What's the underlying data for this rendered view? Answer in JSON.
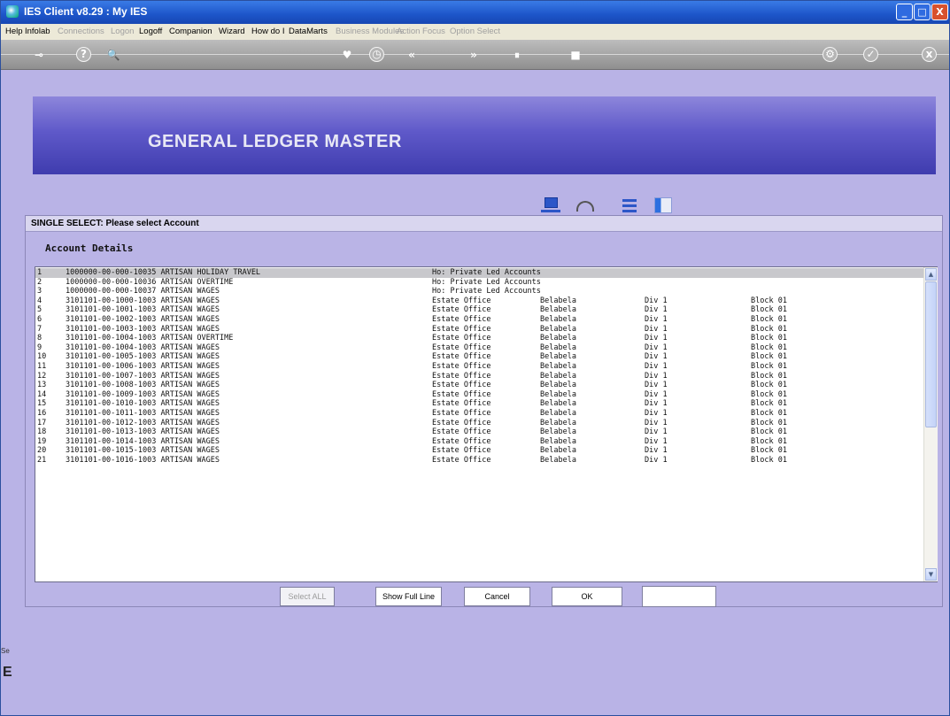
{
  "window": {
    "title": "IES Client v8.29 : My IES",
    "min": "_",
    "max": "□",
    "close": "X"
  },
  "menu": [
    {
      "label": "Help",
      "enabled": true
    },
    {
      "label": "Infolab",
      "enabled": true
    },
    {
      "label": "Connections",
      "enabled": false
    },
    {
      "label": "Logon",
      "enabled": false
    },
    {
      "label": "Logoff",
      "enabled": true
    },
    {
      "label": "Companion",
      "enabled": true
    },
    {
      "label": "Wizard",
      "enabled": true
    },
    {
      "label": "How do I",
      "enabled": true
    },
    {
      "label": "DataMarts",
      "enabled": true
    },
    {
      "label": "Business Modules",
      "enabled": false
    },
    {
      "label": "Action Focus",
      "enabled": false
    },
    {
      "label": "Option Select",
      "enabled": false
    }
  ],
  "toolbar": {
    "icons": [
      "key-icon",
      "help-icon",
      "search-icon",
      "heart-icon",
      "clock-icon",
      "rewind-icon",
      "forward-icon",
      "pause-icon",
      "stop-icon",
      "settings-icon",
      "check-icon",
      "close-icon"
    ],
    "glyphs": {
      "key": "⊸",
      "help": "?",
      "search": "🔍",
      "heart": "♥",
      "clock": "◷",
      "rewind": "«",
      "forward": "»",
      "pause": "⏸",
      "stop": "■",
      "settings": "⚙",
      "check": "✓",
      "close": "x"
    }
  },
  "banner": {
    "title": "GENERAL LEDGER MASTER"
  },
  "dialog": {
    "title": "SINGLE SELECT: Please select Account",
    "section_label": "Account Details",
    "rows": [
      {
        "n": "1",
        "acc": "1000000-00-000-10035 ARTISAN HOLIDAY TRAVEL",
        "f1": "Ho: Private Led Accounts",
        "f2": "",
        "f3": "",
        "f4": ""
      },
      {
        "n": "2",
        "acc": "1000000-00-000-10036 ARTISAN OVERTIME",
        "f1": "Ho: Private Led Accounts",
        "f2": "",
        "f3": "",
        "f4": ""
      },
      {
        "n": "3",
        "acc": "1000000-00-000-10037 ARTISAN WAGES",
        "f1": "Ho: Private Led Accounts",
        "f2": "",
        "f3": "",
        "f4": ""
      },
      {
        "n": "4",
        "acc": "3101101-00-1000-1003 ARTISAN WAGES",
        "f1": "Estate Office",
        "f2": "Belabela",
        "f3": "Div 1",
        "f4": "Block 01"
      },
      {
        "n": "5",
        "acc": "3101101-00-1001-1003 ARTISAN WAGES",
        "f1": "Estate Office",
        "f2": "Belabela",
        "f3": "Div 1",
        "f4": "Block 01"
      },
      {
        "n": "6",
        "acc": "3101101-00-1002-1003 ARTISAN WAGES",
        "f1": "Estate Office",
        "f2": "Belabela",
        "f3": "Div 1",
        "f4": "Block 01"
      },
      {
        "n": "7",
        "acc": "3101101-00-1003-1003 ARTISAN WAGES",
        "f1": "Estate Office",
        "f2": "Belabela",
        "f3": "Div 1",
        "f4": "Block 01"
      },
      {
        "n": "8",
        "acc": "3101101-00-1004-1003 ARTISAN OVERTIME",
        "f1": "Estate Office",
        "f2": "Belabela",
        "f3": "Div 1",
        "f4": "Block 01"
      },
      {
        "n": "9",
        "acc": "3101101-00-1004-1003 ARTISAN WAGES",
        "f1": "Estate Office",
        "f2": "Belabela",
        "f3": "Div 1",
        "f4": "Block 01"
      },
      {
        "n": "10",
        "acc": "3101101-00-1005-1003 ARTISAN WAGES",
        "f1": "Estate Office",
        "f2": "Belabela",
        "f3": "Div 1",
        "f4": "Block 01"
      },
      {
        "n": "11",
        "acc": "3101101-00-1006-1003 ARTISAN WAGES",
        "f1": "Estate Office",
        "f2": "Belabela",
        "f3": "Div 1",
        "f4": "Block 01"
      },
      {
        "n": "12",
        "acc": "3101101-00-1007-1003 ARTISAN WAGES",
        "f1": "Estate Office",
        "f2": "Belabela",
        "f3": "Div 1",
        "f4": "Block 01"
      },
      {
        "n": "13",
        "acc": "3101101-00-1008-1003 ARTISAN WAGES",
        "f1": "Estate Office",
        "f2": "Belabela",
        "f3": "Div 1",
        "f4": "Block 01"
      },
      {
        "n": "14",
        "acc": "3101101-00-1009-1003 ARTISAN WAGES",
        "f1": "Estate Office",
        "f2": "Belabela",
        "f3": "Div 1",
        "f4": "Block 01"
      },
      {
        "n": "15",
        "acc": "3101101-00-1010-1003 ARTISAN WAGES",
        "f1": "Estate Office",
        "f2": "Belabela",
        "f3": "Div 1",
        "f4": "Block 01"
      },
      {
        "n": "16",
        "acc": "3101101-00-1011-1003 ARTISAN WAGES",
        "f1": "Estate Office",
        "f2": "Belabela",
        "f3": "Div 1",
        "f4": "Block 01"
      },
      {
        "n": "17",
        "acc": "3101101-00-1012-1003 ARTISAN WAGES",
        "f1": "Estate Office",
        "f2": "Belabela",
        "f3": "Div 1",
        "f4": "Block 01"
      },
      {
        "n": "18",
        "acc": "3101101-00-1013-1003 ARTISAN WAGES",
        "f1": "Estate Office",
        "f2": "Belabela",
        "f3": "Div 1",
        "f4": "Block 01"
      },
      {
        "n": "19",
        "acc": "3101101-00-1014-1003 ARTISAN WAGES",
        "f1": "Estate Office",
        "f2": "Belabela",
        "f3": "Div 1",
        "f4": "Block 01"
      },
      {
        "n": "20",
        "acc": "3101101-00-1015-1003 ARTISAN WAGES",
        "f1": "Estate Office",
        "f2": "Belabela",
        "f3": "Div 1",
        "f4": "Block 01"
      },
      {
        "n": "21",
        "acc": "3101101-00-1016-1003 ARTISAN WAGES",
        "f1": "Estate Office",
        "f2": "Belabela",
        "f3": "Div 1",
        "f4": "Block 01"
      }
    ],
    "buttons": {
      "select_all": "Select ALL",
      "show_full_line": "Show Full Line",
      "cancel": "Cancel",
      "ok": "OK"
    },
    "quickfind_value": "",
    "scroll_up": "▲",
    "scroll_down": "▼"
  },
  "bottom": {
    "tab_label": "Se",
    "glyph": "E"
  }
}
